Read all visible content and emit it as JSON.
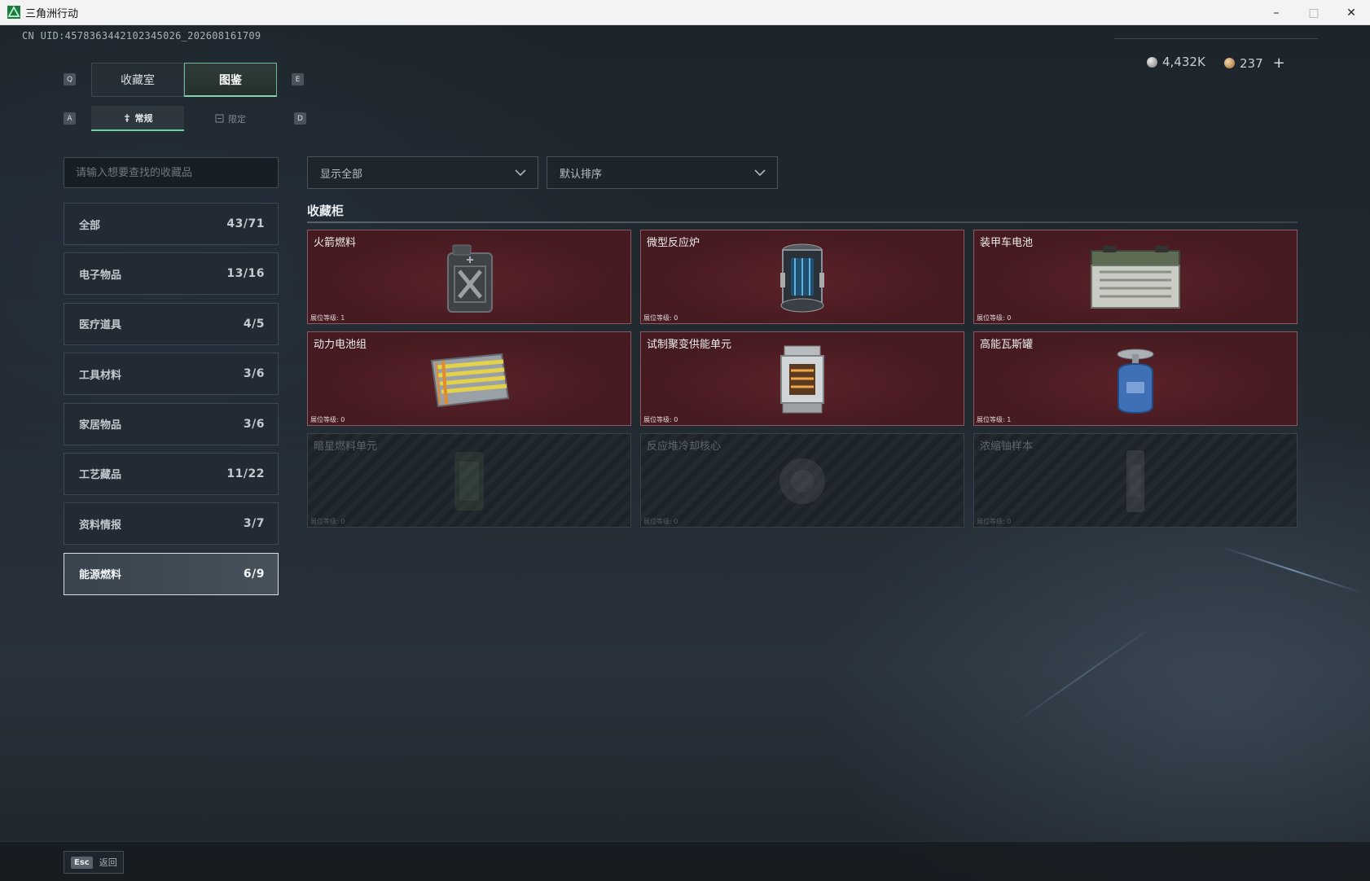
{
  "window": {
    "title": "三角洲行动",
    "minimize": "–",
    "maximize": "□",
    "close": "✕"
  },
  "header": {
    "uid": "CN UID:4578363442102345026_202608161709",
    "currency_silver": "4,432K",
    "currency_gold": "237",
    "currency_add": "+"
  },
  "key_hints": {
    "prev_tab": "Q",
    "next_tab": "E",
    "prev_sub": "A",
    "next_sub": "D"
  },
  "main_tabs": [
    {
      "label": "收藏室",
      "active": false
    },
    {
      "label": "图鉴",
      "active": true
    }
  ],
  "sub_tabs": [
    {
      "label": "常规",
      "active": true
    },
    {
      "label": "限定",
      "active": false
    }
  ],
  "search": {
    "placeholder": "请输入想要查找的收藏品"
  },
  "categories": [
    {
      "label": "全部",
      "count": "43/71"
    },
    {
      "label": "电子物品",
      "count": "13/16"
    },
    {
      "label": "医疗道具",
      "count": "4/5"
    },
    {
      "label": "工具材料",
      "count": "3/6"
    },
    {
      "label": "家居物品",
      "count": "3/6"
    },
    {
      "label": "工艺藏品",
      "count": "11/22"
    },
    {
      "label": "资料情报",
      "count": "3/7"
    },
    {
      "label": "能源燃料",
      "count": "6/9",
      "active": true
    }
  ],
  "filters": {
    "filter_label": "显示全部",
    "sort_label": "默认排序"
  },
  "section": {
    "title": "收藏柜"
  },
  "items": [
    {
      "name": "火箭燃料",
      "level": "展位等级: 1",
      "icon": "jerrycan-icon",
      "locked": false
    },
    {
      "name": "微型反应炉",
      "level": "展位等级: 0",
      "icon": "reactor-icon",
      "locked": false
    },
    {
      "name": "装甲车电池",
      "level": "展位等级: 0",
      "icon": "battery-icon",
      "locked": false
    },
    {
      "name": "动力电池组",
      "level": "展位等级: 0",
      "icon": "battery-pack-icon",
      "locked": false
    },
    {
      "name": "试制聚变供能单元",
      "level": "展位等级: 0",
      "icon": "fusion-unit-icon",
      "locked": false
    },
    {
      "name": "高能瓦斯罐",
      "level": "展位等级: 1",
      "icon": "gas-canister-icon",
      "locked": false
    },
    {
      "name": "暗星燃料单元",
      "level": "展位等级: 0",
      "icon": "fuel-cell-icon",
      "locked": true
    },
    {
      "name": "反应堆冷却核心",
      "level": "展位等级: 0",
      "icon": "cooling-core-icon",
      "locked": true
    },
    {
      "name": "浓缩铀样本",
      "level": "展位等级: 0",
      "icon": "uranium-sample-icon",
      "locked": true
    }
  ],
  "footer": {
    "esc_key": "Esc",
    "back_label": "返回"
  },
  "colors": {
    "accent": "#7fd4a8",
    "card_owned": "#4e1d23",
    "card_locked": "#22292f"
  }
}
